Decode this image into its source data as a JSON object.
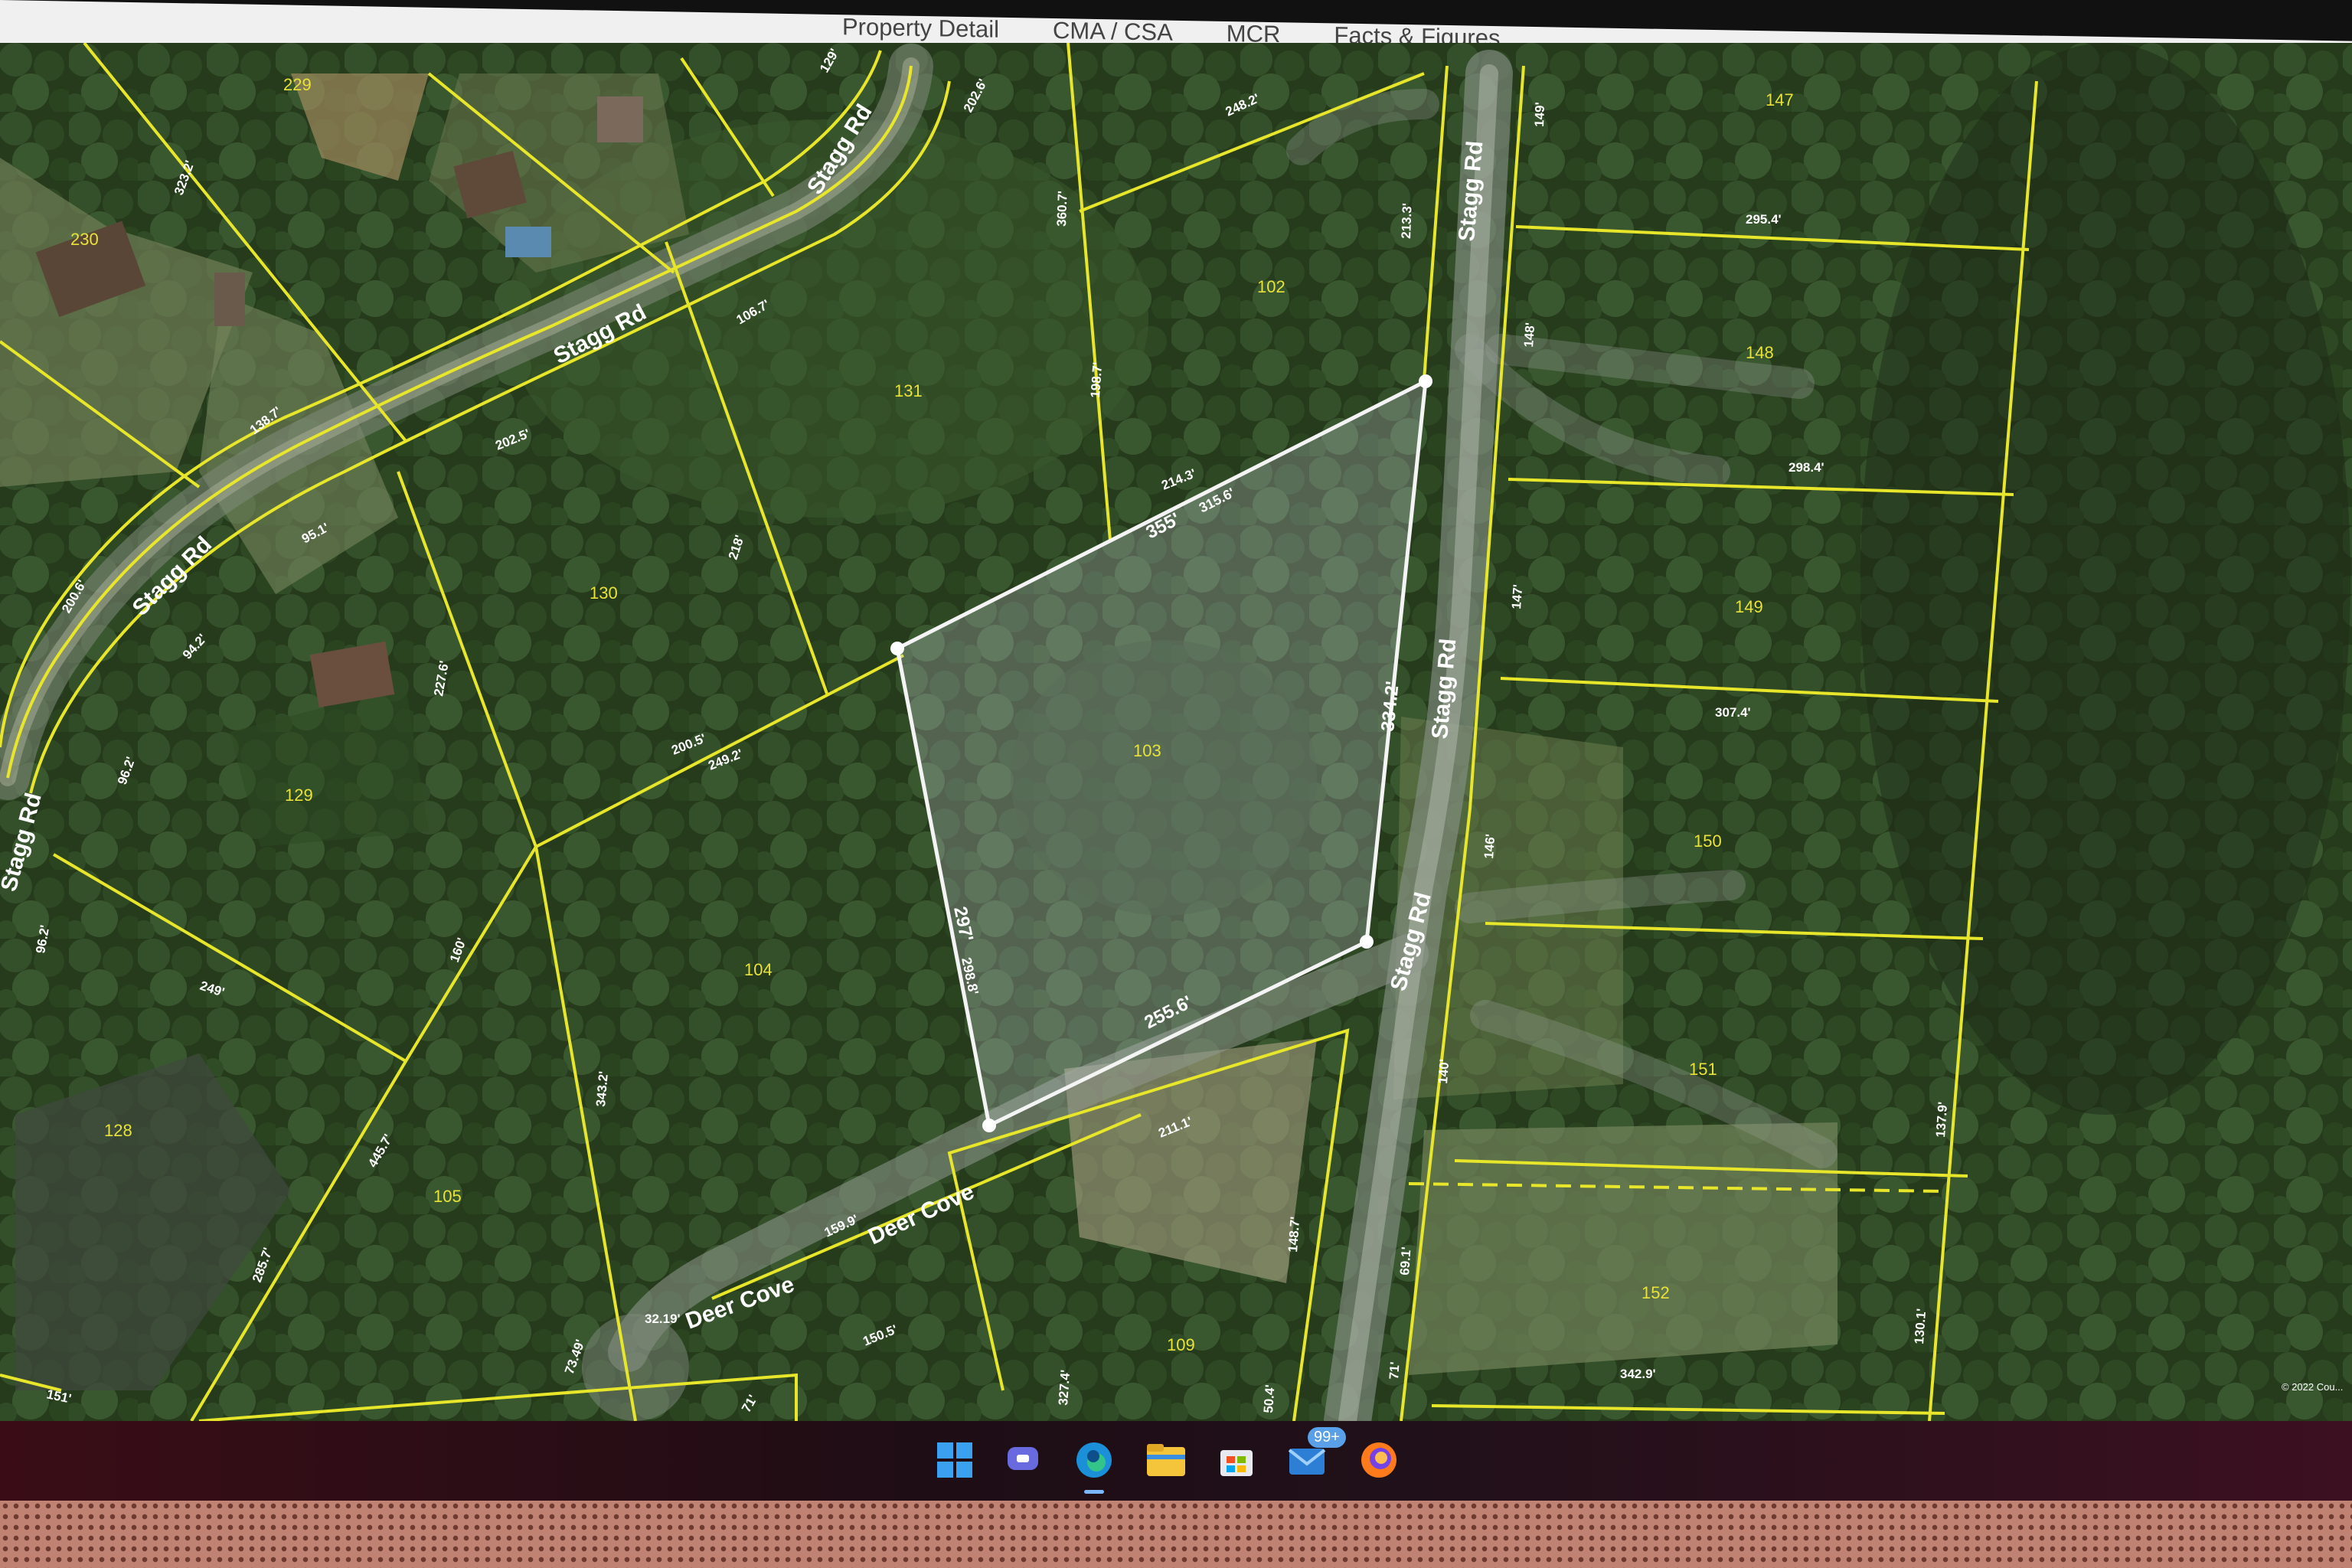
{
  "nav": {
    "tabs": [
      "Property Detail",
      "CMA / CSA",
      "MCR",
      "Facts & Figures"
    ]
  },
  "map": {
    "roads": {
      "stagg_rd_1": "Stagg Rd",
      "stagg_rd_2": "Stagg Rd",
      "stagg_rd_3": "Stagg Rd",
      "stagg_rd_4": "Stagg Rd",
      "stagg_rd_5": "Stagg Rd",
      "stagg_rd_6": "Stagg Rd",
      "deer_cove_1": "Deer Cove",
      "deer_cove_2": "Deer Cove"
    },
    "parcels": {
      "p229": "229",
      "p230": "230",
      "p131": "131",
      "p130": "130",
      "p129": "129",
      "p128": "128",
      "p104": "104",
      "p105": "105",
      "p103": "103",
      "p102": "102",
      "p109": "109",
      "p147": "147",
      "p148": "148",
      "p149": "149",
      "p150": "150",
      "p151": "151",
      "p152": "152"
    },
    "dims": {
      "d129": "129'",
      "d2026": "202.6'",
      "d3232": "323.2'",
      "d2482": "248.2'",
      "d3607": "360.7'",
      "d2133": "213.3'",
      "d149": "149'",
      "d2954": "295.4'",
      "d1067": "106.7'",
      "d1367": "138.7'",
      "d2025": "202.5'",
      "d1987": "198.7'",
      "d148": "148'",
      "d2143": "214.3'",
      "d2984": "298.4'",
      "d2006": "200.6'",
      "d951": "95.1'",
      "d218": "218'",
      "d147": "147'",
      "d942": "94.2'",
      "d2276": "227.6'",
      "d3074": "307.4'",
      "d2005": "200.5'",
      "d2492": "249.2'",
      "d962": "96.2'",
      "d146": "146'",
      "d962b": "96.2'",
      "d160": "160'",
      "d249": "249'",
      "d3432": "343.2'",
      "d4457": "445.7'",
      "d2857": "285.7'",
      "d1599": "159.9'",
      "d3219": "32.19'",
      "d1505": "150.5'",
      "d2111": "211.1'",
      "d1487": "148.7'",
      "d140": "140'",
      "d691": "69.1'",
      "d1379": "137.9'",
      "d1301": "130.1'",
      "d7349": "73.49'",
      "d151": "151'",
      "d71a": "71'",
      "d3274": "327.4'",
      "d504": "50.4'",
      "d71b": "71'",
      "d3429": "342.9'"
    },
    "selection": {
      "north": "355'",
      "north_inner": "315.6'",
      "east": "334.2'",
      "west": "297'",
      "west_inner": "298.8'",
      "south": "255.6'"
    },
    "copyright": "© 2022 Cou..."
  },
  "taskbar": {
    "mail_badge": "99+"
  },
  "colors": {
    "parcel_line": "#e7e62a",
    "label": "#e8e23a",
    "selection": "#ffffff",
    "road_label": "#ffffff"
  }
}
